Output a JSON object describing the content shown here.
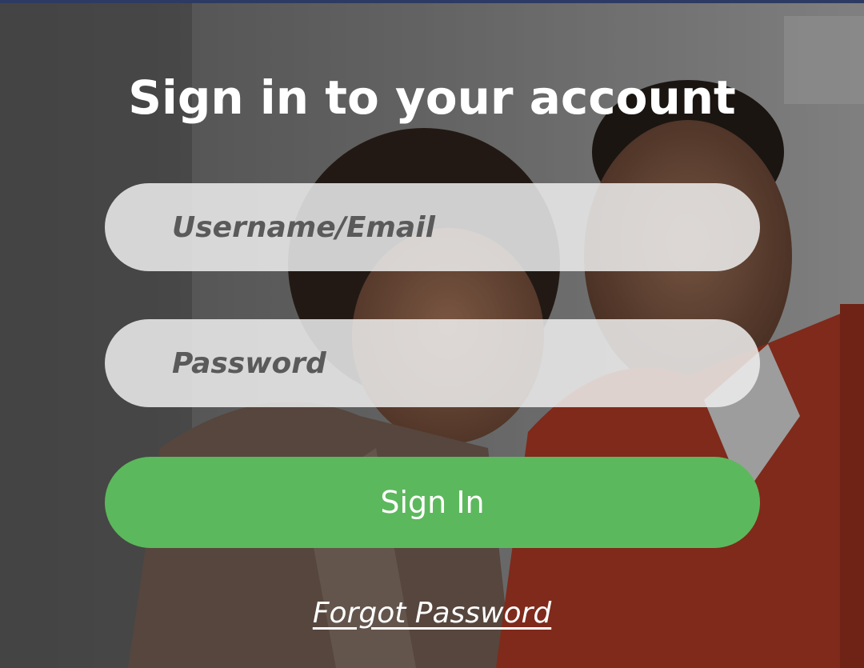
{
  "page": {
    "title": "Sign in to your account"
  },
  "form": {
    "username_placeholder": "Username/Email",
    "username_value": "",
    "password_placeholder": "Password",
    "password_value": "",
    "signin_label": "Sign In",
    "forgot_label": "Forgot Password"
  },
  "colors": {
    "primary_button": "#5cb85c",
    "title_text": "#ffffff",
    "field_background": "#eeeeee",
    "top_strip": "#2d3a63"
  }
}
